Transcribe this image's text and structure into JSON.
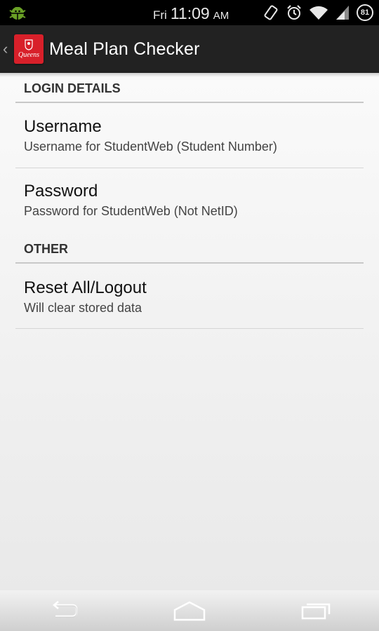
{
  "status_bar": {
    "day": "Fri",
    "time": "11:09",
    "ampm": "AM",
    "battery": "81",
    "icons": [
      "android-debug-icon",
      "rotation-lock-icon",
      "alarm-icon",
      "wifi-icon",
      "signal-icon",
      "battery-icon"
    ]
  },
  "action_bar": {
    "title": "Meal Plan Checker",
    "logo_text": "Queens",
    "logo_color": "#d8202a"
  },
  "preferences": {
    "login_details": {
      "title": "LOGIN DETAILS",
      "username": {
        "title": "Username",
        "summary": "Username for StudentWeb (Student Number)"
      },
      "password": {
        "title": "Password",
        "summary": "Password for StudentWeb (Not NetID)"
      }
    },
    "other": {
      "title": "OTHER",
      "reset": {
        "title": "Reset All/Logout",
        "summary": "Will clear stored data"
      }
    }
  },
  "navigation": {
    "buttons": [
      "back-icon",
      "home-icon",
      "recents-icon"
    ]
  }
}
